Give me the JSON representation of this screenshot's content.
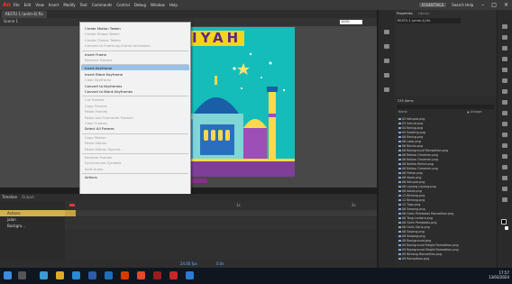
{
  "app": {
    "logo": "An"
  },
  "menubar": {
    "items": [
      "File",
      "Edit",
      "View",
      "Insert",
      "Modify",
      "Text",
      "Commands",
      "Control",
      "Debug",
      "Window",
      "Help"
    ],
    "workspace": "ESSENTIALS",
    "user": "Search Help"
  },
  "document": {
    "tab": "RESTU 1 (anim-4).fla",
    "scene": "Scene 1",
    "zoom": "100%"
  },
  "stage": {
    "title_text": "IYAH"
  },
  "context_menu": {
    "items": [
      {
        "label": "Create Motion Tween",
        "disabled": false
      },
      {
        "label": "Create Shape Tween",
        "disabled": true
      },
      {
        "label": "Create Classic Tween",
        "disabled": true
      },
      {
        "label": "Convert to Frame-by-Frame Animation",
        "disabled": true
      },
      {
        "sep": true
      },
      {
        "label": "Insert Frame",
        "disabled": false
      },
      {
        "label": "Remove Frames",
        "disabled": true
      },
      {
        "sep": true
      },
      {
        "label": "Insert Keyframe",
        "disabled": false,
        "highlighted": true
      },
      {
        "label": "Insert Blank Keyframe",
        "disabled": false
      },
      {
        "label": "Clear Keyframe",
        "disabled": true
      },
      {
        "label": "Convert to Keyframes",
        "disabled": false
      },
      {
        "label": "Convert to Blank Keyframes",
        "disabled": false
      },
      {
        "sep": true
      },
      {
        "label": "Cut Frames",
        "disabled": true
      },
      {
        "label": "Copy Frames",
        "disabled": true
      },
      {
        "label": "Paste Frames",
        "disabled": true
      },
      {
        "label": "Paste and Overwrite Frames",
        "disabled": true
      },
      {
        "label": "Clear Frames",
        "disabled": true
      },
      {
        "label": "Select All Frames",
        "disabled": false
      },
      {
        "sep": true
      },
      {
        "label": "Copy Motion",
        "disabled": true
      },
      {
        "label": "Paste Motion",
        "disabled": true
      },
      {
        "label": "Paste Motion Special...",
        "disabled": true
      },
      {
        "sep": true
      },
      {
        "label": "Reverse Frames",
        "disabled": true
      },
      {
        "label": "Synchronize Symbols",
        "disabled": true
      },
      {
        "label": "Split Audio",
        "disabled": true
      },
      {
        "sep": true
      },
      {
        "label": "Actions",
        "disabled": false
      }
    ]
  },
  "timeline": {
    "tabs": [
      "Timeline",
      "Output"
    ],
    "layers": [
      {
        "name": "Actions",
        "selected": true
      },
      {
        "name": "jalan",
        "selected": false
      },
      {
        "name": "Backgro...",
        "selected": false
      }
    ],
    "frame_marks": [
      "1s",
      "2s"
    ],
    "fps": "24.00 fps",
    "time": "0.0s"
  },
  "properties": {
    "tabs": [
      "Properties",
      "Library"
    ],
    "doc": "RESTU 1 (anim-4).fla"
  },
  "library": {
    "count": "235 Items",
    "col_name": "Name",
    "col_link": "▲ Linkage",
    "items": [
      "02 Ketupat.png",
      "03 Semut.png",
      "04 Bedug.png",
      "05 Sweting.png",
      "06 Bedug.png",
      "06 Latar.png",
      "06 Bandu.png",
      "06 Background Ramadhan.png",
      "06 Bellow Ornamen.png",
      "06 Bellow Ornamen.png",
      "06 Bellow Rental.png",
      "06 Bellow Ornamen.png",
      "06 Pohon.png",
      "06 Awan.png",
      "06 Ketupat.png",
      "06 Layang Layang.png",
      "06 Kotak.png",
      "12 Bintang.png",
      "12 Bintang.png",
      "12 Tugu.png",
      "06 Sawang.png",
      "06 Garis Pembatas Ramadhan.png",
      "06 Tong Lantera.png",
      "08 Garis Pembatas.png",
      "08 Garis Garis.png",
      "08 Sayang.png",
      "08 Sawang.png",
      "08 Background.png",
      "09 Background Masjid Ramadhan.png",
      "09 Background Masjid Ramadhan.png",
      "09 Bintang Ramadhan.png",
      "09 Ramadhan.png"
    ]
  },
  "taskbar": {
    "time": "17:57",
    "date": "13/03/2024"
  }
}
